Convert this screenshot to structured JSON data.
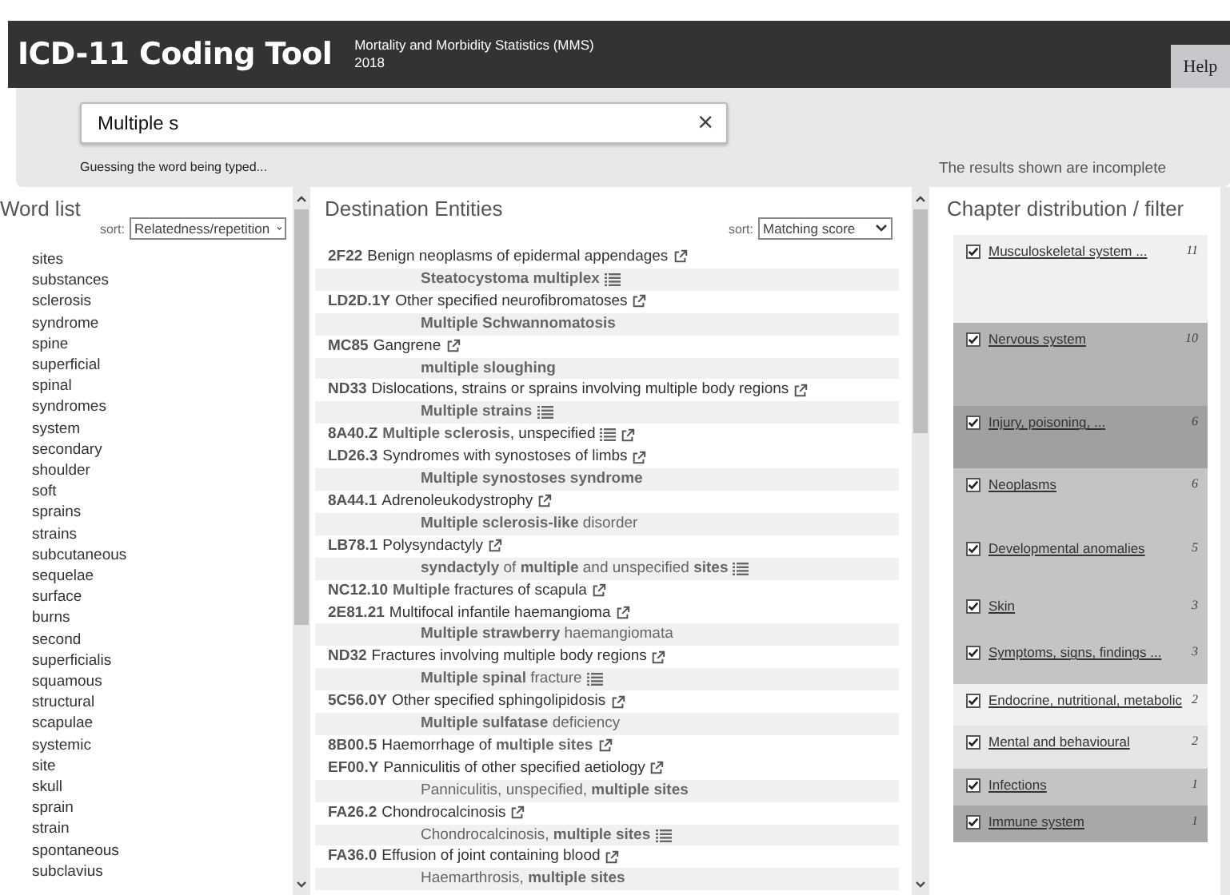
{
  "header": {
    "title": "ICD-11 Coding Tool",
    "subtitle": "Mortality and Morbidity Statistics (MMS)",
    "version": "2018",
    "help": "Help"
  },
  "search": {
    "value": "Multiple s",
    "clear": "×",
    "hint": "Guessing the word being typed...",
    "notice": "The results shown are incomplete"
  },
  "word_list": {
    "title": "Word list",
    "sort_label": "sort:",
    "sort_value": "Relatedness/repetition",
    "words": [
      "sites",
      "substances",
      "sclerosis",
      "syndrome",
      "spine",
      "superficial",
      "spinal",
      "syndromes",
      "system",
      "secondary",
      "shoulder",
      "soft",
      "sprains",
      "strains",
      "subcutaneous",
      "sequelae",
      "surface",
      "burns",
      "second",
      "superficialis",
      "squamous",
      "structural",
      "scapulae",
      "systemic",
      "site",
      "skull",
      "sprain",
      "strain",
      "spontaneous",
      "subclavius"
    ]
  },
  "destination": {
    "title": "Destination Entities",
    "sort_label": "sort:",
    "sort_value": "Matching score",
    "rows": [
      {
        "kind": "entity",
        "code": "2F22",
        "text": "Benign neoplasms of epidermal appendages",
        "list_icon": false
      },
      {
        "kind": "synonym",
        "text": "**Steatocystoma multiplex**",
        "list_icon": true
      },
      {
        "kind": "entity",
        "code": "LD2D.1Y",
        "text": "Other specified neurofibromatoses",
        "list_icon": false
      },
      {
        "kind": "synonym",
        "text": "**Multiple Schwannomatosis**",
        "list_icon": false
      },
      {
        "kind": "entity",
        "code": "MC85",
        "text": "Gangrene",
        "list_icon": false
      },
      {
        "kind": "synonym",
        "text": "**multiple sloughing**",
        "list_icon": false
      },
      {
        "kind": "entity",
        "code": "ND33",
        "text": "Dislocations, strains or sprains involving multiple body regions",
        "list_icon": false
      },
      {
        "kind": "synonym",
        "text": "**Multiple strains**",
        "list_icon": true
      },
      {
        "kind": "entity",
        "code": "8A40.Z",
        "text": "**Multiple sclerosis**, unspecified",
        "list_icon": true
      },
      {
        "kind": "entity",
        "code": "LD26.3",
        "text": "Syndromes with synostoses of limbs",
        "list_icon": false
      },
      {
        "kind": "synonym",
        "text": "**Multiple synostoses syndrome**",
        "list_icon": false
      },
      {
        "kind": "entity",
        "code": "8A44.1",
        "text": "Adrenoleukodystrophy",
        "list_icon": false
      },
      {
        "kind": "synonym",
        "text": "**Multiple sclerosis-like** disorder",
        "list_icon": false
      },
      {
        "kind": "entity",
        "code": "LB78.1",
        "text": "Polysyndactyly",
        "list_icon": false
      },
      {
        "kind": "synonym",
        "text": "**syndactyly** of **multiple** and unspecified **sites**",
        "list_icon": true
      },
      {
        "kind": "entity",
        "code": "NC12.10",
        "text": "**Multiple** fractures of scapula",
        "list_icon": false
      },
      {
        "kind": "entity",
        "code": "2E81.21",
        "text": "Multifocal infantile haemangioma",
        "list_icon": false
      },
      {
        "kind": "synonym",
        "text": "**Multiple strawberry** haemangiomata",
        "list_icon": false
      },
      {
        "kind": "entity",
        "code": "ND32",
        "text": "Fractures involving multiple body regions",
        "list_icon": false
      },
      {
        "kind": "synonym",
        "text": "**Multiple spinal** fracture",
        "list_icon": true
      },
      {
        "kind": "entity",
        "code": "5C56.0Y",
        "text": "Other specified sphingolipidosis",
        "list_icon": false
      },
      {
        "kind": "synonym",
        "text": "**Multiple sulfatase** deficiency",
        "list_icon": false
      },
      {
        "kind": "entity",
        "code": "8B00.5",
        "text": "Haemorrhage of **multiple sites**",
        "list_icon": false
      },
      {
        "kind": "entity",
        "code": "EF00.Y",
        "text": "Panniculitis of other specified aetiology",
        "list_icon": false
      },
      {
        "kind": "synonym",
        "text": "Panniculitis, unspecified, **multiple sites**",
        "list_icon": false
      },
      {
        "kind": "entity",
        "code": "FA26.2",
        "text": "Chondrocalcinosis",
        "list_icon": false
      },
      {
        "kind": "synonym",
        "text": "Chondrocalcinosis, **multiple sites**",
        "list_icon": true
      },
      {
        "kind": "entity",
        "code": "FA36.0",
        "text": "Effusion of joint containing blood",
        "list_icon": false
      },
      {
        "kind": "synonym",
        "text": "Haemarthrosis, **multiple sites**",
        "list_icon": false
      }
    ]
  },
  "chapters": {
    "title": "Chapter distribution / filter",
    "items": [
      {
        "label": "Musculoskeletal system ...",
        "count": "11",
        "checked": true,
        "color": "#f0f0f0"
      },
      {
        "label": "Nervous system",
        "count": "10",
        "checked": true,
        "color": "#b4b4b4"
      },
      {
        "label": "Injury, poisoning, ...",
        "count": "6",
        "checked": true,
        "color": "#a0a0a0"
      },
      {
        "label": "Neoplasms",
        "count": "6",
        "checked": true,
        "color": "#c4c4c4"
      },
      {
        "label": "Developmental anomalies",
        "count": "5",
        "checked": true,
        "color": "#c4c4c4"
      },
      {
        "label": "Skin",
        "count": "3",
        "checked": true,
        "color": "#c4c4c4"
      },
      {
        "label": "Symptoms, signs, findings ...",
        "count": "3",
        "checked": true,
        "color": "#c4c4c4"
      },
      {
        "label": "Endocrine, nutritional, metabolic",
        "count": "2",
        "checked": true,
        "color": "#f0f0f0"
      },
      {
        "label": "Mental and behavioural",
        "count": "2",
        "checked": true,
        "color": "#e6e6e6"
      },
      {
        "label": "Infections",
        "count": "1",
        "checked": true,
        "color": "#c4c4c4"
      },
      {
        "label": "Immune system",
        "count": "1",
        "checked": true,
        "color": "#a8a8a8"
      }
    ]
  }
}
